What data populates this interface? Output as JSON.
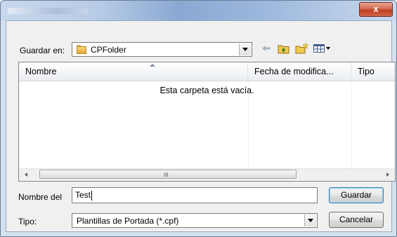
{
  "window": {
    "close_label": "x"
  },
  "save_in": {
    "label": "Guardar en:",
    "value": "CPFolder"
  },
  "toolbar": {
    "back_icon": "back-arrow-icon",
    "up_icon": "up-one-level-icon",
    "new_folder_icon": "new-folder-icon",
    "view_menu_icon": "view-menu-icon"
  },
  "list": {
    "columns": [
      "Nombre",
      "Fecha de modifica...",
      "Tipo"
    ],
    "empty_message": "Esta carpeta está vacía.",
    "scroll_grip": "III"
  },
  "filename": {
    "label": "Nombre del",
    "value": "Test"
  },
  "filetype": {
    "label": "Tipo:",
    "value": "Plantillas de Portada (*.cpf)"
  },
  "buttons": {
    "save": "Guardar",
    "cancel": "Cancelar"
  },
  "colors": {
    "titlebar": "#8aa8d2",
    "close_button": "#c13d22",
    "dialog_bg": "#f0f0f0"
  }
}
